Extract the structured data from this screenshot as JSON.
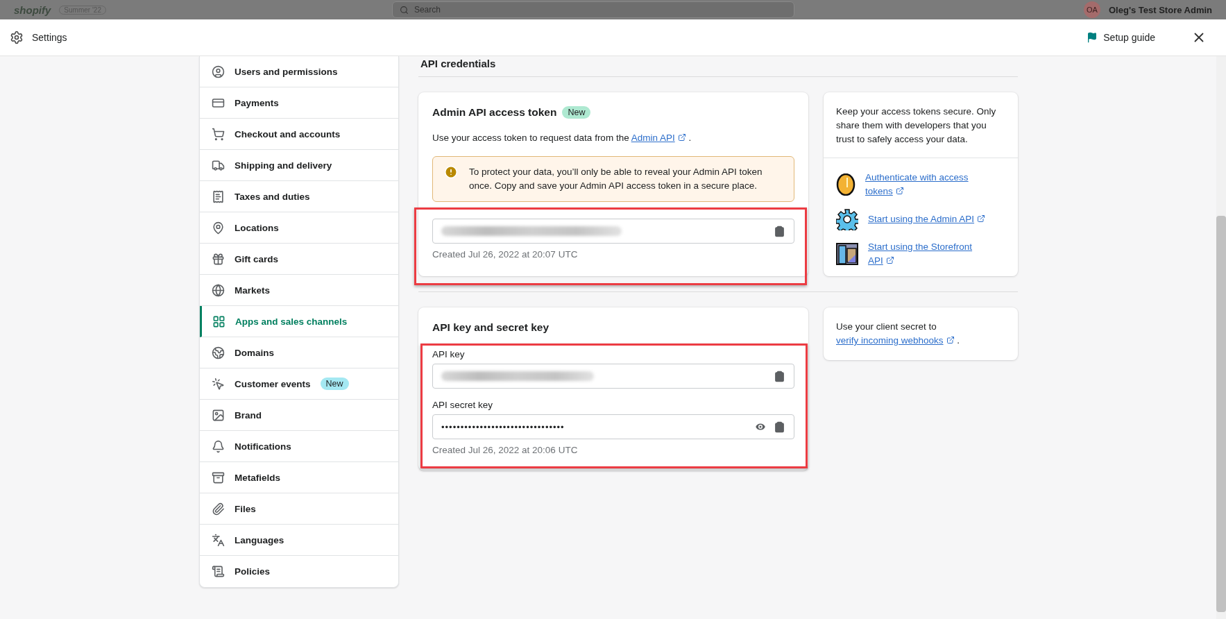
{
  "backdrop": {
    "brand": "shopify",
    "badge": "Summer '22",
    "search": {
      "placeholder": "Search"
    },
    "avatar": "OA",
    "store": "Oleg's Test Store Admin"
  },
  "header": {
    "title": "Settings",
    "setup_guide": "Setup guide"
  },
  "sidebar": {
    "items": [
      {
        "label": "Users and permissions",
        "selected": false
      },
      {
        "label": "Payments",
        "selected": false
      },
      {
        "label": "Checkout and accounts",
        "selected": false
      },
      {
        "label": "Shipping and delivery",
        "selected": false
      },
      {
        "label": "Taxes and duties",
        "selected": false
      },
      {
        "label": "Locations",
        "selected": false
      },
      {
        "label": "Gift cards",
        "selected": false
      },
      {
        "label": "Markets",
        "selected": false
      },
      {
        "label": "Apps and sales channels",
        "selected": true
      },
      {
        "label": "Domains",
        "selected": false
      },
      {
        "label": "Customer events",
        "selected": false,
        "badge": "New"
      },
      {
        "label": "Brand",
        "selected": false
      },
      {
        "label": "Notifications",
        "selected": false
      },
      {
        "label": "Metafields",
        "selected": false
      },
      {
        "label": "Files",
        "selected": false
      },
      {
        "label": "Languages",
        "selected": false
      },
      {
        "label": "Policies",
        "selected": false
      }
    ]
  },
  "section": {
    "title": "API credentials"
  },
  "token_card": {
    "title": "Admin API access token",
    "badge": "New",
    "description": {
      "before": "Use your access token to request data from the ",
      "link": "Admin API",
      "after": " ."
    },
    "warning": "To protect your data, you’ll only be able to reveal your Admin API token once. Copy and save your Admin API access token in a secure place.",
    "created": "Created Jul 26, 2022 at 20:07 UTC"
  },
  "token_aside": {
    "text": "Keep your access tokens secure. Only share them with developers that you trust to safely access your data.",
    "links": [
      {
        "label": "Authenticate with access tokens"
      },
      {
        "label": "Start using the Admin API"
      },
      {
        "label": "Start using the Storefront API"
      }
    ]
  },
  "keys_card": {
    "title": "API key and secret key",
    "fields": [
      {
        "label": "API key",
        "kind": "blurred"
      },
      {
        "label": "API secret key",
        "kind": "masked",
        "value": "••••••••••••••••••••••••••••••••"
      }
    ],
    "created": "Created Jul 26, 2022 at 20:06 UTC"
  },
  "keys_aside": {
    "before": "Use your client secret to ",
    "link": "verify incoming webhooks",
    "after": " ."
  }
}
